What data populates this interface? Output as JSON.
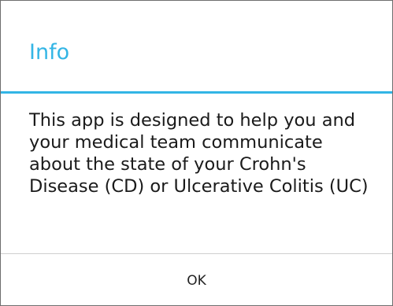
{
  "dialog": {
    "title": "Info",
    "message": "This app is designed to help you and your medical team communicate about the state of your Crohn's Disease (CD) or Ulcerative Colitis (UC)",
    "ok_label": "OK"
  },
  "colors": {
    "accent": "#33b5e5"
  }
}
